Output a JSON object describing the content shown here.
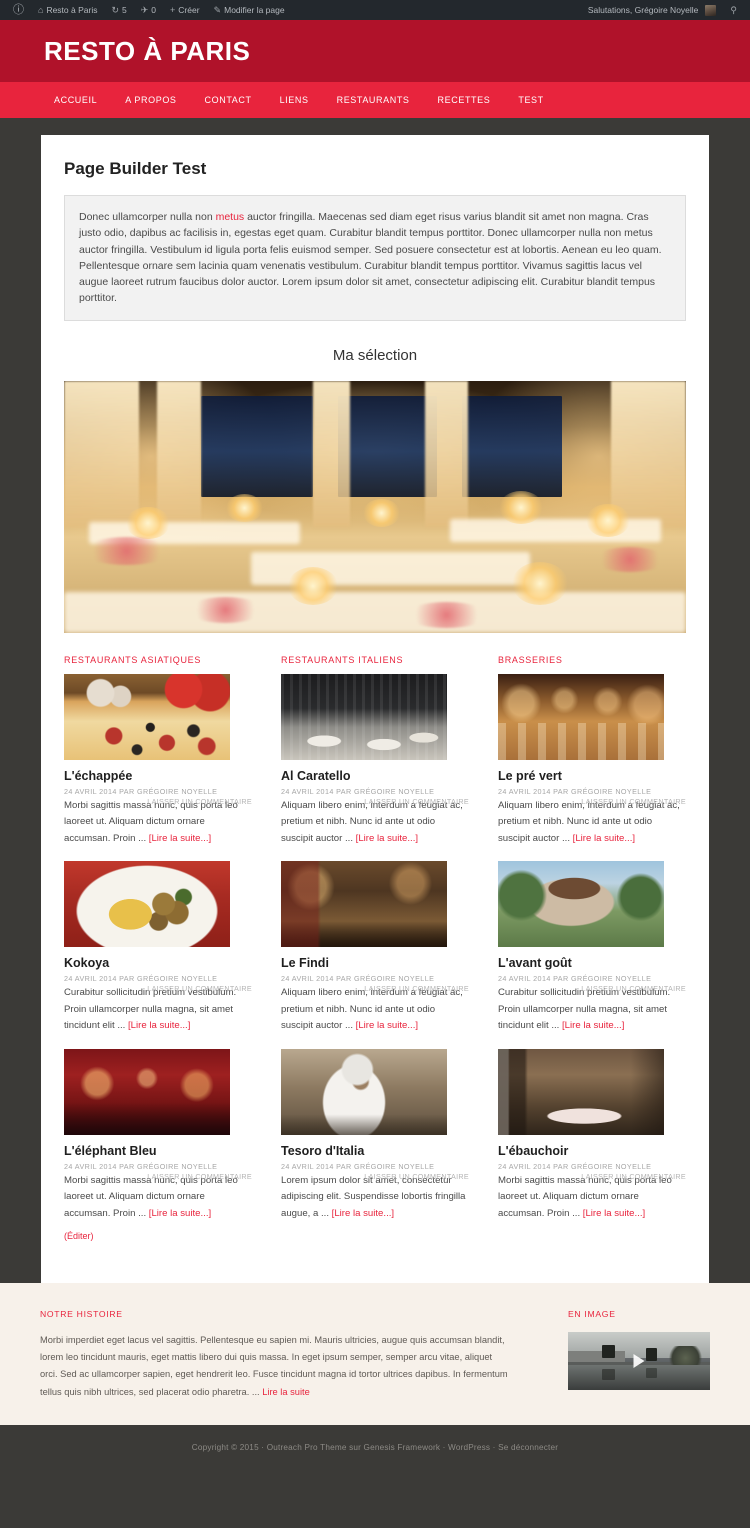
{
  "adminbar": {
    "logo_icon": "wordpress-logo-icon",
    "site_name": "Resto à Paris",
    "site_icon": "home-icon",
    "updates_icon": "updates-icon",
    "updates_count": "5",
    "comments_icon": "comments-icon",
    "comments_count": "0",
    "new_icon": "plus-icon",
    "new_label": "Créer",
    "edit_icon": "pencil-icon",
    "edit_label": "Modifier la page",
    "greeting": "Salutations, Grégoire Noyelle",
    "avatar_name": "avatar",
    "search_icon": "search-icon"
  },
  "header": {
    "site_title": "RESTO À PARIS",
    "brand_color": "#b0122a",
    "nav_color": "#e8243d"
  },
  "nav": {
    "items": [
      {
        "label": "ACCUEIL"
      },
      {
        "label": "A PROPOS"
      },
      {
        "label": "CONTACT"
      },
      {
        "label": "LIENS"
      },
      {
        "label": "RESTAURANTS"
      },
      {
        "label": "RECETTES"
      },
      {
        "label": "TEST"
      }
    ]
  },
  "main": {
    "page_title": "Page Builder Test",
    "intro_prefix": "Donec ullamcorper nulla non ",
    "intro_link": "metus",
    "intro_rest": " auctor fringilla. Maecenas sed diam eget risus varius blandit sit amet non magna. Cras justo odio, dapibus ac facilisis in, egestas eget quam. Curabitur blandit tempus porttitor. Donec ullamcorper nulla non metus auctor fringilla. Vestibulum id ligula porta felis euismod semper. Sed posuere consectetur est at lobortis. Aenean eu leo quam. Pellentesque ornare sem lacinia quam venenatis vestibulum. Curabitur blandit tempus porttitor. Vivamus sagittis lacus vel augue laoreet rutrum faucibus dolor auctor. Lorem ipsum dolor sit amet, consectetur adipiscing elit. Curabitur blandit tempus porttitor.",
    "section_heading": "Ma sélection",
    "hero_image_name": "banquet-hall-candlelight-image"
  },
  "columns": [
    {
      "heading": "RESTAURANTS ASIATIQUES",
      "posts": [
        {
          "thumb": "pizza-image",
          "title": "L'échappée",
          "meta": "24 AVRIL 2014 PAR GRÉGOIRE NOYELLE",
          "comment_label": "LAISSER UN COMMENTAIRE",
          "excerpt": "Morbi sagittis massa nunc, quis porta leo laoreet ut. Aliquam dictum ornare accumsan. Proin ... ",
          "more_label": "[Lire la suite...]"
        },
        {
          "thumb": "plated-dish-image",
          "title": "Kokoya",
          "meta": "24 AVRIL 2014 PAR GRÉGOIRE NOYELLE",
          "comment_label": "LAISSER UN COMMENTAIRE",
          "excerpt": "Curabitur sollicitudin pretium vestibulum. Proin ullamcorper nulla magna, sit amet tincidunt elit ... ",
          "more_label": "[Lire la suite...]"
        },
        {
          "thumb": "red-dining-room-image",
          "title": "L'éléphant Bleu",
          "meta": "24 AVRIL 2014 PAR GRÉGOIRE NOYELLE",
          "comment_label": "LAISSER UN COMMENTAIRE",
          "excerpt": "Morbi sagittis massa nunc, quis porta leo laoreet ut. Aliquam dictum ornare accumsan. Proin ... ",
          "more_label": "[Lire la suite...]",
          "edit_label": "(Éditer)"
        }
      ]
    },
    {
      "heading": "RESTAURANTS ITALIENS",
      "posts": [
        {
          "thumb": "modern-restaurant-interior-image",
          "title": "Al Caratello",
          "meta": "24 AVRIL 2014 PAR GRÉGOIRE NOYELLE",
          "comment_label": "LAISSER UN COMMENTAIRE",
          "excerpt": "Aliquam libero enim, interdum a feugiat ac, pretium et nibh. Nunc id ante ut odio suscipit auctor ... ",
          "more_label": "[Lire la suite...]"
        },
        {
          "thumb": "rustic-tavern-image",
          "title": "Le Findi",
          "meta": "24 AVRIL 2014 PAR GRÉGOIRE NOYELLE",
          "comment_label": "LAISSER UN COMMENTAIRE",
          "excerpt": "Aliquam libero enim, interdum a feugiat ac, pretium et nibh. Nunc id ante ut odio suscipit auctor ... ",
          "more_label": "[Lire la suite...]"
        },
        {
          "thumb": "chef-cooking-image",
          "title": "Tesoro d'Italia",
          "meta": "24 AVRIL 2014 PAR GRÉGOIRE NOYELLE",
          "comment_label": "LAISSER UN COMMENTAIRE",
          "excerpt": "Lorem ipsum dolor sit amet, consectetur adipiscing elit. Suspendisse lobortis fringilla augue, a ... ",
          "more_label": "[Lire la suite...]"
        }
      ]
    },
    {
      "heading": "BRASSERIES",
      "posts": [
        {
          "thumb": "brasserie-hall-image",
          "title": "Le pré vert",
          "meta": "24 AVRIL 2014 PAR GRÉGOIRE NOYELLE",
          "comment_label": "LAISSER UN COMMENTAIRE",
          "excerpt": "Aliquam libero enim, interdum a feugiat ac, pretium et nibh. Nunc id ante ut odio suscipit auctor ... ",
          "more_label": "[Lire la suite...]"
        },
        {
          "thumb": "village-house-image",
          "title": "L'avant goût",
          "meta": "24 AVRIL 2014 PAR GRÉGOIRE NOYELLE",
          "comment_label": "LAISSER UN COMMENTAIRE",
          "excerpt": "Curabitur sollicitudin pretium vestibulum. Proin ullamcorper nulla magna, sit amet tincidunt elit ... ",
          "more_label": "[Lire la suite...]"
        },
        {
          "thumb": "bistro-table-image",
          "title": "L'ébauchoir",
          "meta": "24 AVRIL 2014 PAR GRÉGOIRE NOYELLE",
          "comment_label": "LAISSER UN COMMENTAIRE",
          "excerpt": "Morbi sagittis massa nunc, quis porta leo laoreet ut. Aliquam dictum ornare accumsan. Proin ... ",
          "more_label": "[Lire la suite...]"
        }
      ]
    }
  ],
  "footer": {
    "widget_left_title": "NOTRE HISTOIRE",
    "widget_left_text": "Morbi imperdiet eget lacus vel sagittis. Pellentesque eu sapien mi. Mauris ultricies, augue quis accumsan blandit, lorem leo tincidunt mauris, eget mattis libero dui quis massa. In eget ipsum semper, semper arcu vitae, aliquet orci. Sed ac ullamcorper sapien, eget hendrerit leo. Fusce tincidunt magna id tortor ultrices dapibus. In fermentum tellus quis nibh ultrices, sed placerat odio pharetra. ... ",
    "widget_left_link": "Lire la suite",
    "widget_right_title": "EN IMAGE",
    "video_name": "skateboarder-video-thumbnail",
    "play_icon": "play-icon",
    "copyright": "Copyright © 2015 · Outreach Pro Theme sur Genesis Framework · WordPress · Se déconnecter"
  }
}
